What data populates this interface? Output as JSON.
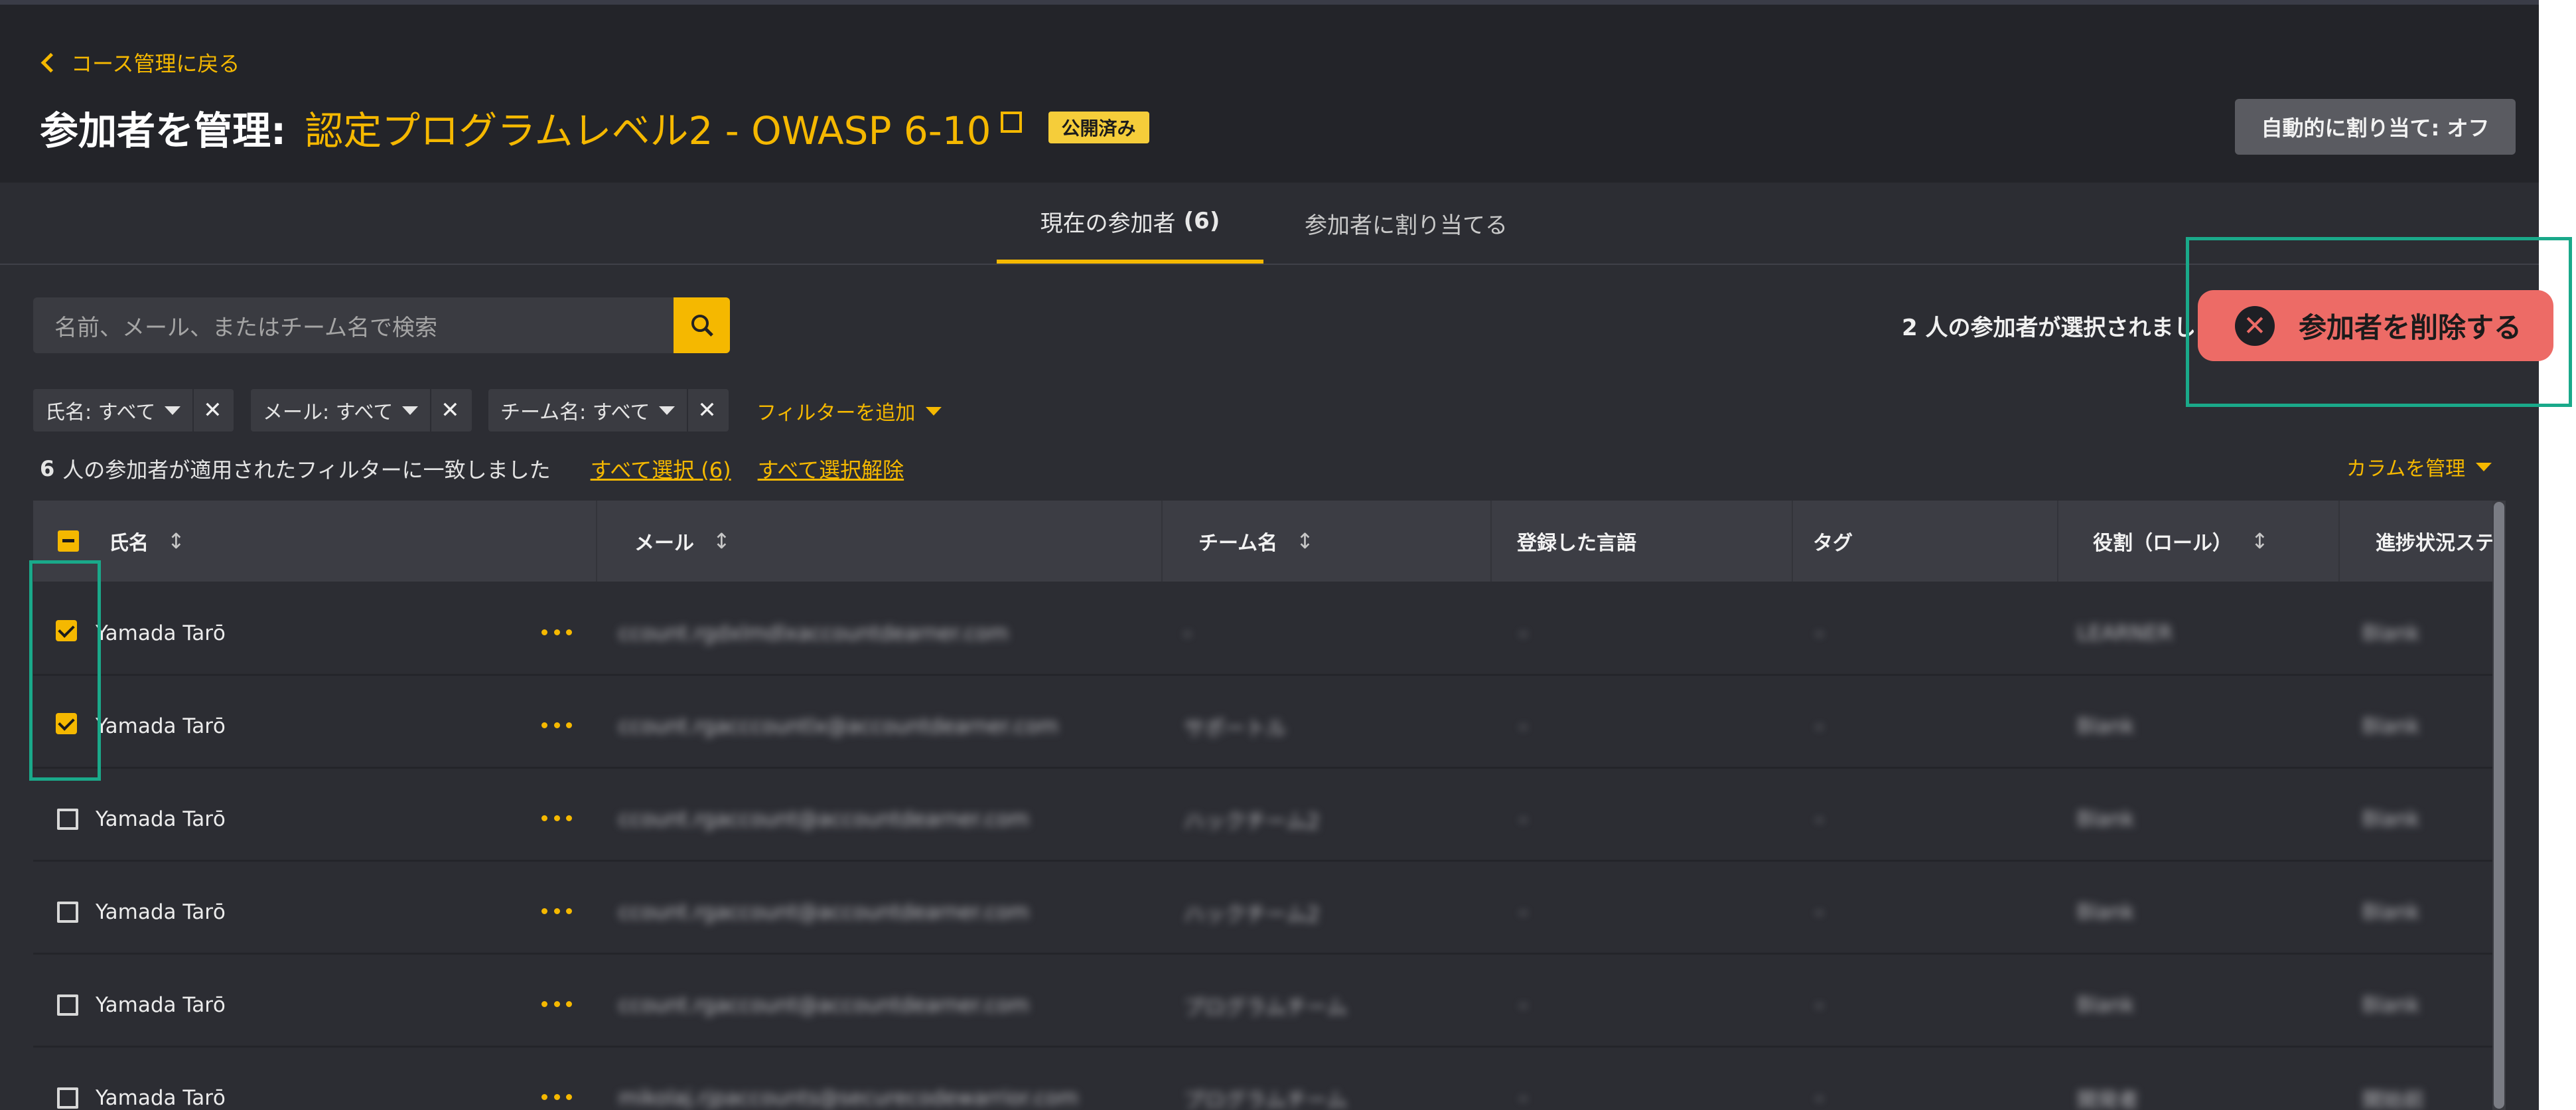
{
  "header": {
    "back_label": "コース管理に戻る",
    "title_prefix": "参加者を管理:",
    "program_name": "認定プログラムレベル2 - OWASP 6-10",
    "status_badge": "公開済み",
    "auto_assign_button": "自動的に割り当て: オフ"
  },
  "tabs": [
    {
      "label": "現在の参加者",
      "count": "(6)",
      "active": true
    },
    {
      "label": "参加者に割り当てる",
      "active": false
    }
  ],
  "search": {
    "placeholder": "名前、メール、またはチーム名で検索"
  },
  "selection": {
    "selected_text": "2 人の参加者が選択されました",
    "delete_button": "参加者を削除する"
  },
  "filters": [
    {
      "label": "氏名: すべて"
    },
    {
      "label": "メール: すべて"
    },
    {
      "label": "チーム名: すべて"
    }
  ],
  "add_filter": "フィルターを追加",
  "results": {
    "count": "6",
    "text": "人の参加者が適用されたフィルターに一致しました",
    "select_all": "すべて選択 (6)",
    "deselect_all": "すべて選択解除"
  },
  "manage_columns": "カラムを管理",
  "table": {
    "columns": [
      "氏名",
      "メール",
      "チーム名",
      "登録した言語",
      "タグ",
      "役割（ロール）",
      "進捗状況ステ"
    ],
    "rows": [
      {
        "name": "Yamada Tarō",
        "checked": true,
        "email": "ccount.rgdxlmdlxaccountdearner.com",
        "team": "-",
        "language": "-",
        "tag": "-",
        "role": "LEARNER",
        "status": "Blank"
      },
      {
        "name": "Yamada Tarō",
        "checked": true,
        "email": "ccount.rgacccountlx@accountdearner.com",
        "team": "サポートル",
        "language": "-",
        "tag": "-",
        "role": "Blank",
        "status": "Blank"
      },
      {
        "name": "Yamada Tarō",
        "checked": false,
        "email": "ccount.rgaccount@accountdearner.com",
        "team": "ハックチーム2",
        "language": "-",
        "tag": "-",
        "role": "Blank",
        "status": "Blank"
      },
      {
        "name": "Yamada Tarō",
        "checked": false,
        "email": "ccount.rgaccount@accountdearner.com",
        "team": "ハックチーム2",
        "language": "-",
        "tag": "-",
        "role": "Blank",
        "status": "Blank"
      },
      {
        "name": "Yamada Tarō",
        "checked": false,
        "email": "ccount.rgaccount@accountdearner.com",
        "team": "プログラムチーム",
        "language": "-",
        "tag": "-",
        "role": "Blank",
        "status": "Blank"
      },
      {
        "name": "Yamada Tarō",
        "checked": false,
        "email": "mikolaj.rjpaccounts@securecodewarrior.com",
        "team": "プログラムチーム",
        "language": "-",
        "tag": "-",
        "role": "開発者",
        "status": "開始前"
      }
    ]
  },
  "colors": {
    "accent": "#f5b800",
    "danger": "#ed6b66",
    "highlight": "#1aa98a",
    "header_bg": "#232429",
    "page_bg": "#2c2d33"
  }
}
